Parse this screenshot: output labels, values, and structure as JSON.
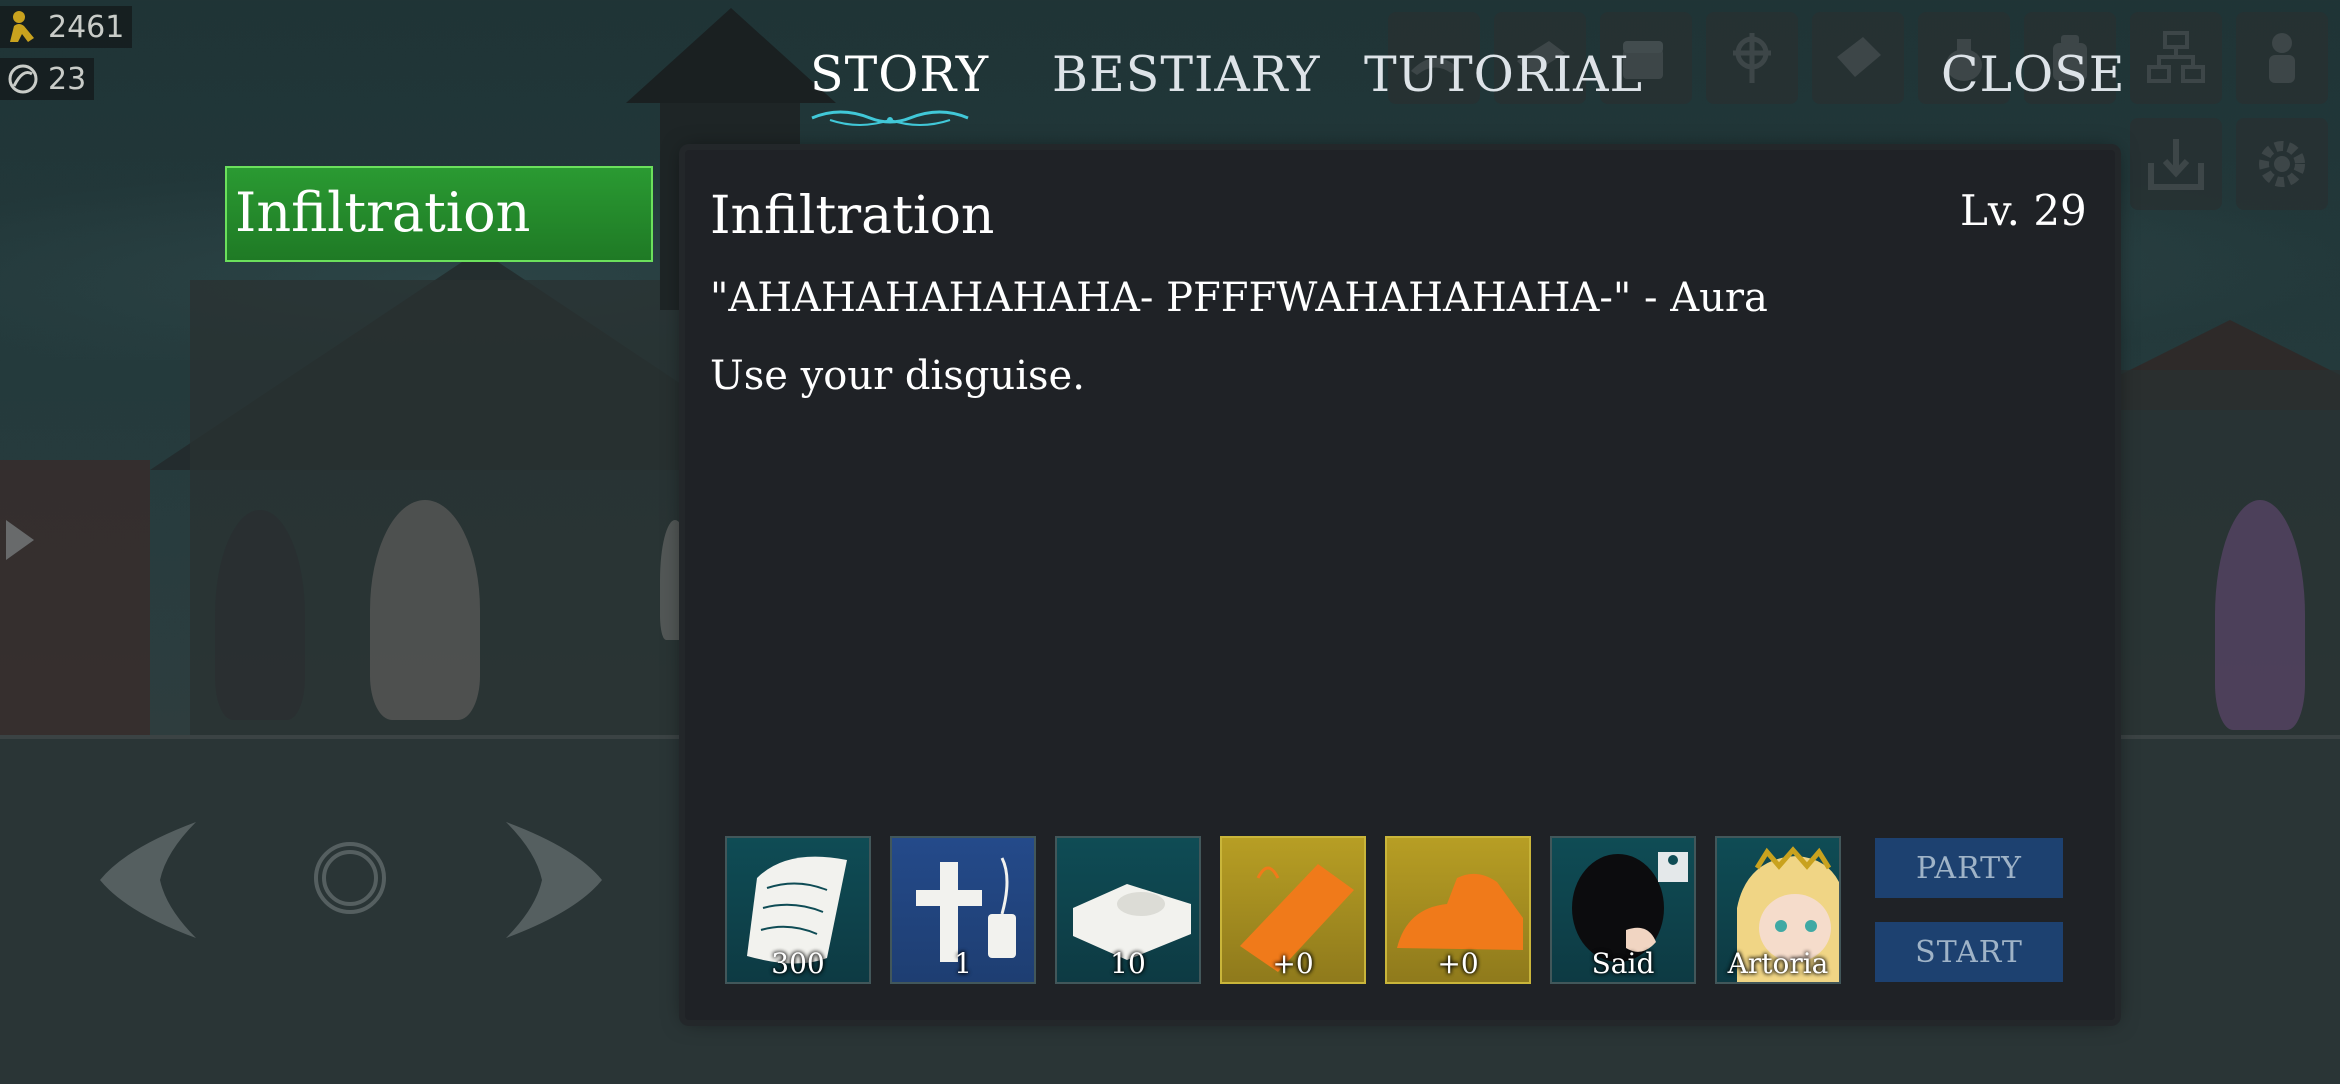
{
  "resources": {
    "gold": "2461",
    "potions": "23"
  },
  "tabs": [
    {
      "label": "STORY",
      "active": true
    },
    {
      "label": "BESTIARY",
      "active": false
    },
    {
      "label": "TUTORIAL",
      "active": false
    },
    {
      "label": "CLOSE",
      "active": false
    }
  ],
  "quest_list": [
    {
      "label": "Infiltration",
      "selected": true
    }
  ],
  "panel": {
    "title": "Infiltration",
    "level": "Lv. 29",
    "quote": "\"AHAHAHAHAHAHA- PFFFWAHAHAHAHA-\" - Aura",
    "description": "Use your disguise."
  },
  "rewards": [
    {
      "label": "300",
      "icon": "scroll-xp-icon"
    },
    {
      "label": "1",
      "icon": "cross-phone-icon"
    },
    {
      "label": "10",
      "icon": "bed-icon"
    },
    {
      "label": "+0",
      "icon": "orange-card-icon"
    },
    {
      "label": "+0",
      "icon": "orange-item-icon"
    },
    {
      "label": "Said",
      "icon": "hooded-character-portrait"
    },
    {
      "label": "Artoria",
      "icon": "blonde-character-portrait"
    }
  ],
  "buttons": {
    "party": "PARTY",
    "start": "START"
  },
  "top_icons": [
    "hat-icon",
    "book-icon",
    "chest-icon",
    "target-icon",
    "card-icon",
    "bag-icon",
    "backpack-icon",
    "hierarchy-icon",
    "person-icon",
    "save-icon",
    "gear-icon"
  ],
  "colors": {
    "selected_green": "#2a9a32",
    "button_blue": "#1d4170",
    "panel_bg": "#1f2226",
    "reward_gold": "#b79e24",
    "reward_teal": "#0f4c55"
  }
}
